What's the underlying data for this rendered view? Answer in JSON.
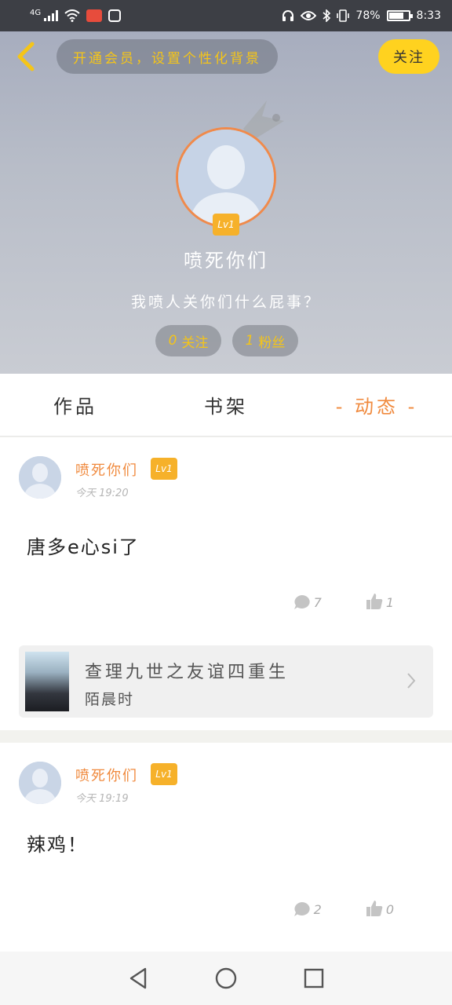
{
  "status_bar": {
    "network": "4G",
    "battery_level": "78%",
    "time": "8:33",
    "icons": [
      "signal-icon",
      "wifi-icon",
      "app-badge-icon",
      "hand-icon",
      "headset-icon",
      "eye-icon",
      "bluetooth-icon",
      "vibrate-icon",
      "battery-icon"
    ]
  },
  "header": {
    "vip_banner": "开通会员，设置个性化背景",
    "follow_label": "关注",
    "level": "Lv1",
    "username": "喷死你们",
    "bio": "我喷人关你们什么屁事？",
    "following_count": "0",
    "following_label": "关注",
    "fans_count": "1",
    "fans_label": "粉丝"
  },
  "tabs": [
    {
      "label": "作品",
      "active": false
    },
    {
      "label": "书架",
      "active": false
    },
    {
      "label": "- 动态 -",
      "active": true
    }
  ],
  "posts": [
    {
      "author": "喷死你们",
      "level": "Lv1",
      "time": "今天 19:20",
      "content": "唐多e心si了",
      "comments": "7",
      "likes": "1",
      "book": {
        "title": "查理九世之友谊四重生",
        "author": "陌晨时"
      }
    },
    {
      "author": "喷死你们",
      "level": "Lv1",
      "time": "今天 19:19",
      "content": "辣鸡！",
      "comments": "2",
      "likes": "0"
    }
  ],
  "colors": {
    "accent_orange": "#f08a3e",
    "level_badge": "#f6b12a",
    "follow_yellow": "#ffd21f",
    "vip_text": "#f5c518"
  }
}
